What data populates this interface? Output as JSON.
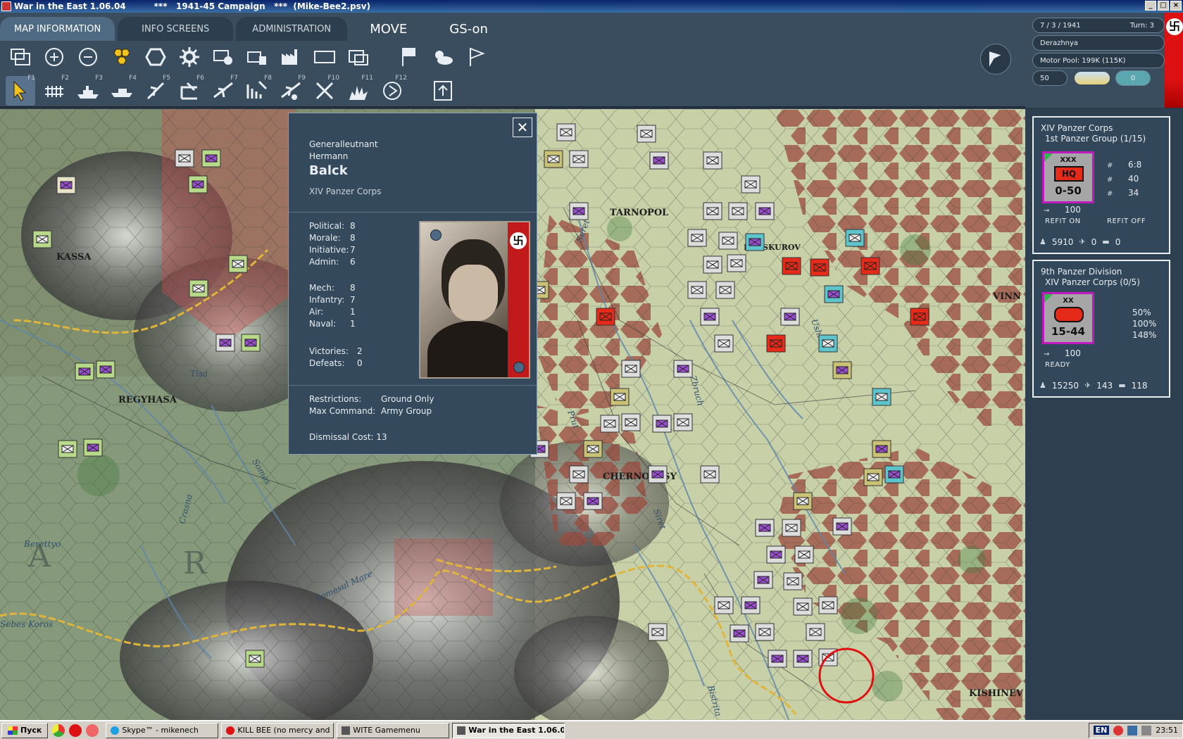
{
  "window": {
    "title": "War in the East 1.06.04",
    "subtitle": "***   1941-45 Campaign   ***  (Mike-Bee2.psv)",
    "controls": [
      "_",
      "□",
      "×"
    ]
  },
  "tabs": [
    {
      "label": "MAP INFORMATION",
      "active": true
    },
    {
      "label": "INFO SCREENS",
      "active": false
    },
    {
      "label": "ADMINISTRATION",
      "active": false
    },
    {
      "label": "MOVE",
      "active": false
    },
    {
      "label": "GS-on",
      "active": false
    }
  ],
  "toolbar_row1": [
    "windows-icon",
    "zoom-in-icon",
    "zoom-out-icon",
    "hex-icon",
    "zoc-icon",
    "gear-icon",
    "unit-icon",
    "supply-icon",
    "factory-icon",
    "frame-icon",
    "unit-frame-icon",
    "flag-icon",
    "weather-icon",
    "pennant-icon"
  ],
  "toolbar_row2": [
    {
      "icon": "cursor-icon",
      "key": "F1",
      "selected": true
    },
    {
      "icon": "rail-icon",
      "key": "F2"
    },
    {
      "icon": "naval-icon",
      "key": "F3"
    },
    {
      "icon": "ship-icon",
      "key": "F4"
    },
    {
      "icon": "air-strike-icon",
      "key": "F5"
    },
    {
      "icon": "air-transfer-icon",
      "key": "F6"
    },
    {
      "icon": "air-base-icon",
      "key": "F7"
    },
    {
      "icon": "air-group-icon",
      "key": "F8"
    },
    {
      "icon": "air-drop-icon",
      "key": "F9"
    },
    {
      "icon": "air-recon-icon",
      "key": "F10"
    },
    {
      "icon": "explosion-icon",
      "key": "F11"
    },
    {
      "icon": "end-turn-icon",
      "key": "F12"
    },
    {
      "icon": "upload-icon",
      "key": ""
    }
  ],
  "status": {
    "date": "7 / 3 / 1941",
    "turn": "Turn: 3",
    "location": "Derazhnya",
    "motor_pool": "Motor Pool: 199K (115K)",
    "value_a": "50",
    "value_b": "0"
  },
  "map": {
    "cities": [
      "TARNOPOL",
      "KASSA",
      "REGYHASA",
      "CHERNOVTSY",
      "KISHINEV",
      "VINN",
      "PROSKUROV"
    ],
    "rivers": [
      "Seret",
      "Zbruch",
      "Ushitsa",
      "Tisa",
      "Somes",
      "Crasna",
      "Berettyo",
      "Somesul Mare",
      "Bistrita",
      "Siret",
      "Prut",
      "Sebes Koros"
    ],
    "letters": [
      "A",
      "R"
    ]
  },
  "leader": {
    "rank": "Generalleutnant",
    "first_name": "Hermann",
    "last_name": "Balck",
    "command": "XIV Panzer Corps",
    "stats1": [
      {
        "label": "Political:",
        "value": "8"
      },
      {
        "label": "Morale:",
        "value": "8"
      },
      {
        "label": "Initiative:",
        "value": "7"
      },
      {
        "label": "Admin:",
        "value": "6"
      }
    ],
    "stats2": [
      {
        "label": "Mech:",
        "value": "8"
      },
      {
        "label": "Infantry:",
        "value": "7"
      },
      {
        "label": "Air:",
        "value": "1"
      },
      {
        "label": "Naval:",
        "value": "1"
      }
    ],
    "record": [
      {
        "label": "Victories:",
        "value": "2"
      },
      {
        "label": "Defeats:",
        "value": "0"
      }
    ],
    "restrictions_label": "Restrictions:",
    "restrictions": "Ground Only",
    "max_command_label": "Max Command:",
    "max_command": "Army Group",
    "dismissal_label": "Dismissal Cost:",
    "dismissal": "13",
    "close": "✕"
  },
  "units": [
    {
      "name": "XIV Panzer Corps",
      "parent": "1st Panzer Group (1/15)",
      "size": "XXX",
      "symbol": "HQ",
      "value": "0-50",
      "stats": [
        {
          "icon": "#",
          "value": "6:8"
        },
        {
          "icon": "#",
          "value": "40"
        },
        {
          "icon": "#",
          "value": "34"
        }
      ],
      "supply": "100",
      "buttons": [
        "REFIT ON",
        "REFIT OFF"
      ],
      "men": "5910",
      "guns": "0",
      "afv": "0"
    },
    {
      "name": "9th Panzer Division",
      "parent": "XIV Panzer Corps (0/5)",
      "size": "XX",
      "symbol": "",
      "value": "15-44",
      "stats": [
        {
          "icon": "",
          "value": "50%"
        },
        {
          "icon": "",
          "value": "100%"
        },
        {
          "icon": "",
          "value": "148%"
        }
      ],
      "supply": "100",
      "buttons": [
        "READY"
      ],
      "men": "15250",
      "guns": "143",
      "afv": "118"
    }
  ],
  "taskbar": {
    "start": "Пуск",
    "tasks": [
      {
        "label": "Skype™ - mikenech",
        "active": false
      },
      {
        "label": "KILL BEE (no mercy and ...",
        "active": false
      },
      {
        "label": "WITE Gamemenu",
        "active": false
      },
      {
        "label": "War in the East 1.06.0...",
        "active": true
      }
    ],
    "lang": "EN",
    "clock": "23:51"
  },
  "colors": {
    "panel": "#3a4d5e",
    "german_hq": "#e52a1a",
    "selection": "#c019c0",
    "hex_red": "#9a4a3e"
  }
}
